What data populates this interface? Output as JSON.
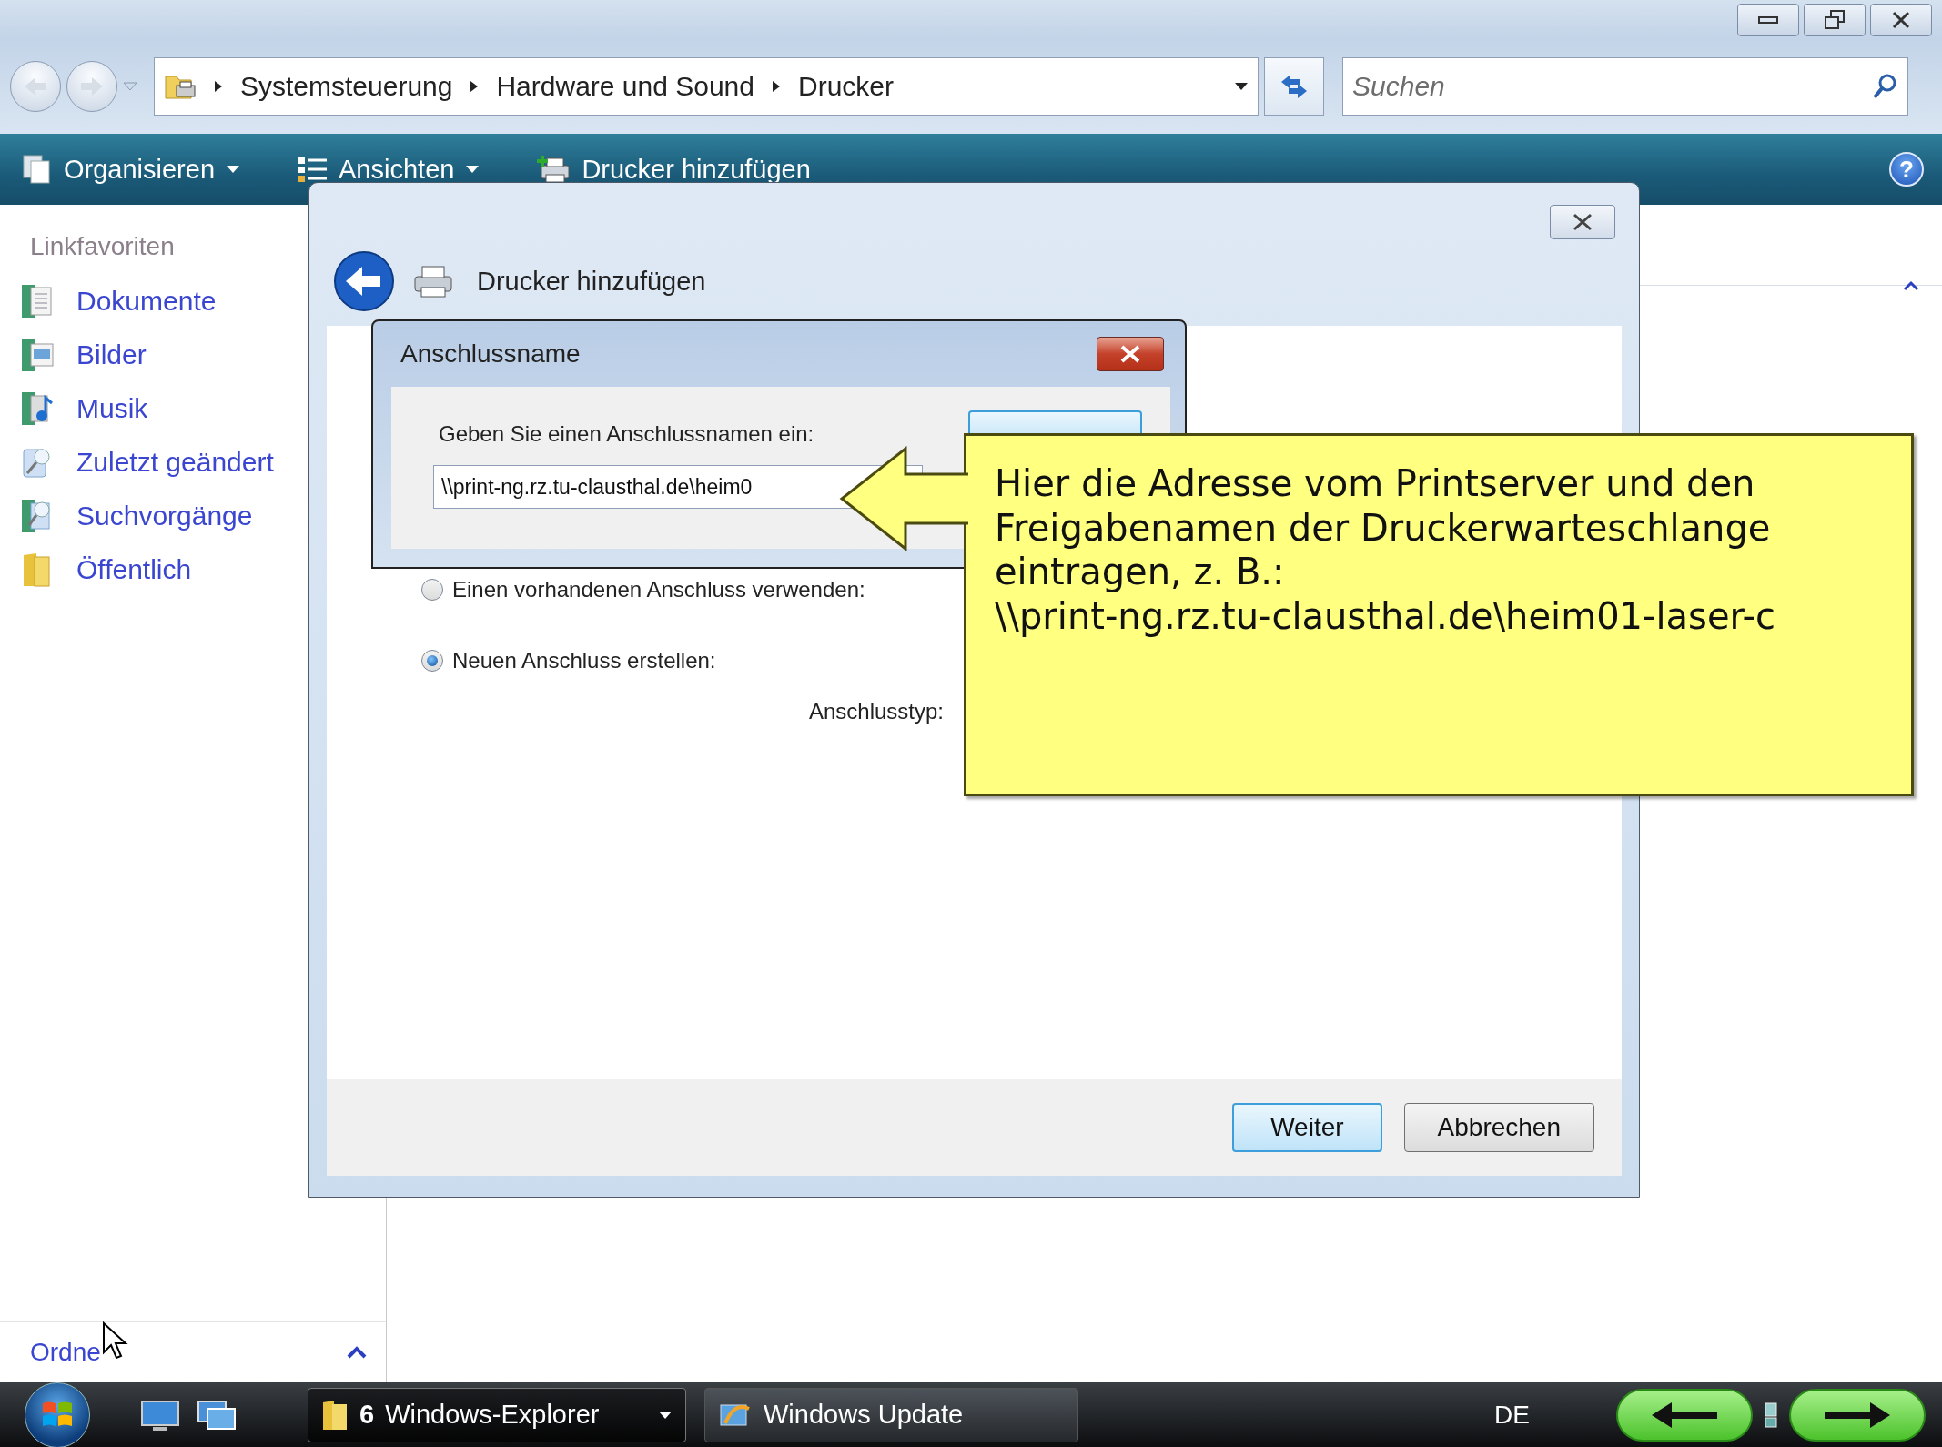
{
  "explorer": {
    "breadcrumb": [
      "Systemsteuerung",
      "Hardware und Sound",
      "Drucker"
    ],
    "search": {
      "placeholder": "Suchen"
    },
    "toolbar": [
      {
        "label": "Organisieren",
        "kind": "menu"
      },
      {
        "label": "Ansichten",
        "kind": "menu"
      },
      {
        "label": "Drucker hinzufügen",
        "kind": "action"
      }
    ],
    "help_label": "?",
    "sidebar": {
      "title": "Linkfavoriten",
      "items": [
        {
          "label": "Dokumente"
        },
        {
          "label": "Bilder"
        },
        {
          "label": "Musik"
        },
        {
          "label": "Zuletzt geändert"
        },
        {
          "label": "Suchvorgänge"
        },
        {
          "label": "Öffentlich"
        }
      ],
      "folders_label": "Ordne"
    }
  },
  "wizard": {
    "title": "Drucker hinzufügen",
    "options": [
      {
        "label": "Einen vorhandenen Anschluss verwenden:",
        "selected": false
      },
      {
        "label": "Neuen Anschluss erstellen:",
        "selected": true
      }
    ],
    "port_type_label": "Anschlusstyp:",
    "buttons": [
      {
        "label": "Weiter",
        "default": true
      },
      {
        "label": "Abbrechen",
        "default": false
      }
    ]
  },
  "port_dialog": {
    "title": "Anschlussname",
    "prompt": "Geben Sie einen Anschlussnamen ein:",
    "value": "\\\\print-ng.rz.tu-clausthal.de\\heim0"
  },
  "callout": {
    "lines": [
      "Hier die Adresse vom Printserver und den",
      "Freigabenamen der Druckerwarteschlange",
      "eintragen, z. B.:",
      "\\\\print-ng.rz.tu-clausthal.de\\heim01-laser-c"
    ]
  },
  "taskbar": {
    "tasks": [
      {
        "label": "Windows-Explorer",
        "count": "6",
        "selected": true
      },
      {
        "label": "Windows Update",
        "selected": false
      }
    ],
    "language": "DE"
  }
}
